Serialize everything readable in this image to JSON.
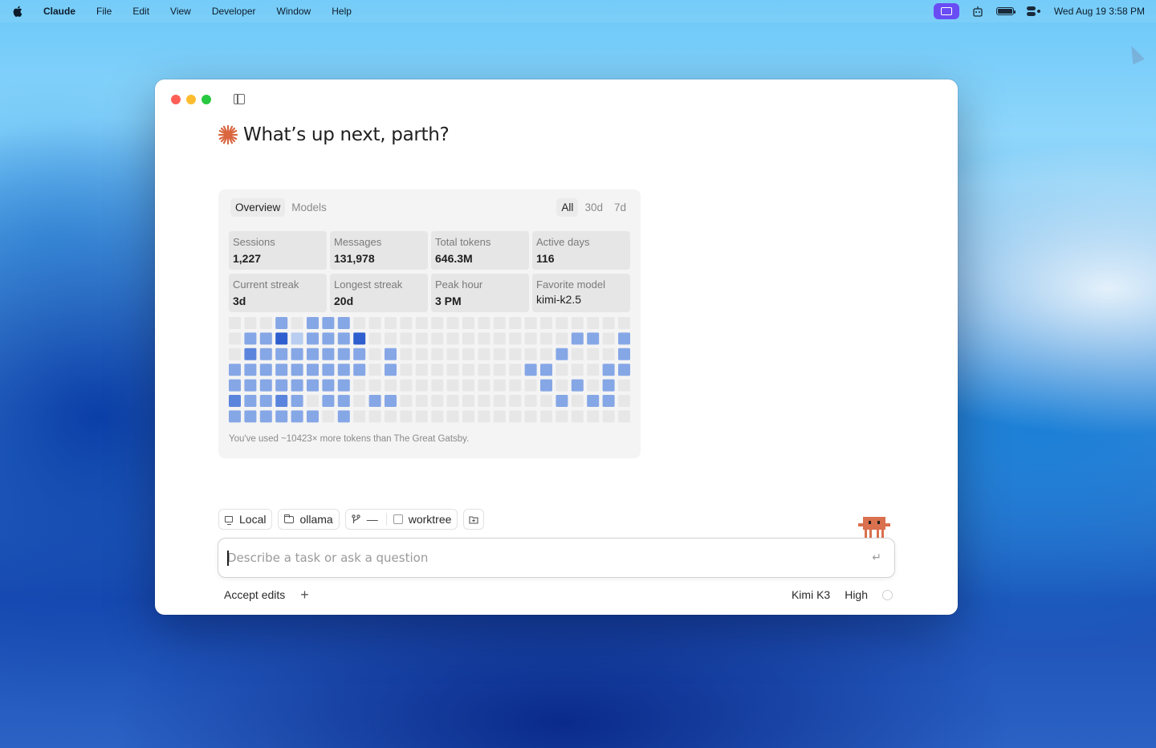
{
  "menubar": {
    "app_name": "Claude",
    "menus": [
      "File",
      "Edit",
      "View",
      "Developer",
      "Window",
      "Help"
    ],
    "clock": "Wed Aug 19  3:58 PM",
    "icons": [
      "screen-share-icon",
      "robot-icon",
      "battery-icon",
      "control-center-icon"
    ]
  },
  "window": {
    "greeting": "What’s up next, parth?"
  },
  "stats_card": {
    "tabs": [
      {
        "label": "Overview",
        "active": true
      },
      {
        "label": "Models",
        "active": false
      }
    ],
    "ranges": [
      {
        "label": "All",
        "active": true
      },
      {
        "label": "30d",
        "active": false
      },
      {
        "label": "7d",
        "active": false
      }
    ],
    "stats": [
      {
        "label": "Sessions",
        "value": "1,227"
      },
      {
        "label": "Messages",
        "value": "131,978"
      },
      {
        "label": "Total tokens",
        "value": "646.3M"
      },
      {
        "label": "Active days",
        "value": "116"
      },
      {
        "label": "Current streak",
        "value": "3d"
      },
      {
        "label": "Longest streak",
        "value": "20d"
      },
      {
        "label": "Peak hour",
        "value": "3 PM"
      },
      {
        "label": "Favorite model",
        "value": "kimi-k2.5"
      }
    ],
    "fact": "You've used ~10423× more tokens than The Great Gatsby."
  },
  "chart_data": {
    "type": "heatmap",
    "rows": 7,
    "columns": 26,
    "levels": [
      [
        0,
        0,
        0,
        2,
        0,
        2,
        2,
        2,
        0,
        0,
        0,
        0,
        0,
        0,
        0,
        0,
        0,
        0,
        0,
        0,
        0,
        0,
        0,
        0,
        0,
        0
      ],
      [
        0,
        2,
        2,
        4,
        1,
        2,
        2,
        2,
        4,
        0,
        0,
        0,
        0,
        0,
        0,
        0,
        0,
        0,
        0,
        0,
        0,
        0,
        2,
        2,
        0,
        2
      ],
      [
        0,
        3,
        2,
        2,
        2,
        2,
        2,
        2,
        2,
        0,
        2,
        0,
        0,
        0,
        0,
        0,
        0,
        0,
        0,
        0,
        0,
        2,
        0,
        0,
        0,
        2
      ],
      [
        2,
        2,
        2,
        2,
        2,
        2,
        2,
        2,
        2,
        0,
        2,
        0,
        0,
        0,
        0,
        0,
        0,
        0,
        0,
        2,
        2,
        0,
        0,
        0,
        2,
        2
      ],
      [
        2,
        2,
        2,
        2,
        2,
        2,
        2,
        2,
        0,
        0,
        0,
        0,
        0,
        0,
        0,
        0,
        0,
        0,
        0,
        0,
        2,
        0,
        2,
        0,
        2,
        0
      ],
      [
        3,
        2,
        2,
        3,
        2,
        0,
        2,
        2,
        0,
        2,
        2,
        0,
        0,
        0,
        0,
        0,
        0,
        0,
        0,
        0,
        0,
        2,
        0,
        2,
        2,
        0
      ],
      [
        2,
        2,
        2,
        2,
        2,
        2,
        0,
        2,
        0,
        0,
        0,
        0,
        0,
        0,
        0,
        0,
        0,
        0,
        0,
        0,
        0,
        0,
        0,
        0,
        0,
        0
      ]
    ],
    "colors": [
      "#e7e7e7",
      "#b9cdf0",
      "#86a7e6",
      "#5b85dc",
      "#2f5fcf"
    ]
  },
  "chips": {
    "local": "Local",
    "ollama": "ollama",
    "branch": "—",
    "worktree": "worktree"
  },
  "prompt": {
    "placeholder": "Describe a task or ask a question"
  },
  "bottombar": {
    "accept_edits": "Accept edits",
    "add": "+",
    "model": "Kimi K3",
    "effort": "High"
  }
}
